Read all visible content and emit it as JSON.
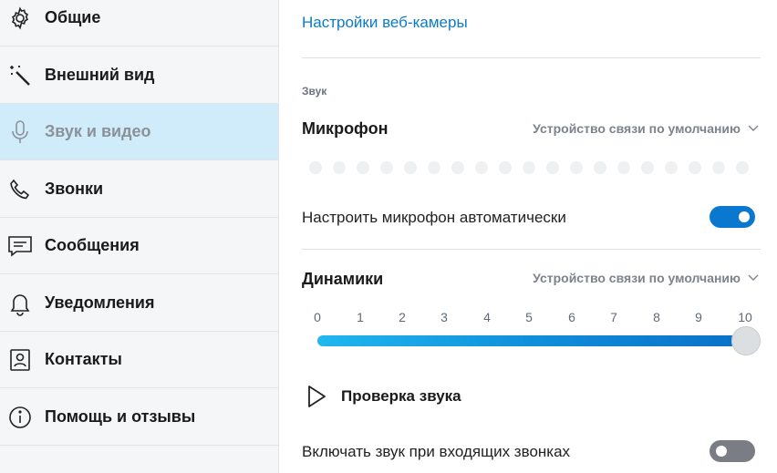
{
  "sidebar": {
    "items": [
      {
        "label": "Общие",
        "icon": "gear-icon"
      },
      {
        "label": "Внешний вид",
        "icon": "magic-wand-icon"
      },
      {
        "label": "Звук и видео",
        "icon": "microphone-icon",
        "active": true
      },
      {
        "label": "Звонки",
        "icon": "phone-icon"
      },
      {
        "label": "Сообщения",
        "icon": "message-icon"
      },
      {
        "label": "Уведомления",
        "icon": "bell-icon"
      },
      {
        "label": "Контакты",
        "icon": "contacts-icon"
      },
      {
        "label": "Помощь и отзывы",
        "icon": "info-icon"
      }
    ]
  },
  "main": {
    "webcam_link": "Настройки веб-камеры",
    "section_label": "Звук",
    "microphone": {
      "heading": "Микрофон",
      "device": "Устройство связи по умолчанию",
      "auto_adjust_label": "Настроить микрофон автоматически",
      "auto_adjust_on": true
    },
    "speakers": {
      "heading": "Динамики",
      "device": "Устройство связи по умолчанию",
      "ticks": [
        "0",
        "1",
        "2",
        "3",
        "4",
        "5",
        "6",
        "7",
        "8",
        "9",
        "10"
      ],
      "volume": 10
    },
    "test_sound_label": "Проверка звука",
    "incoming_calls": {
      "label": "Включать звук при входящих звонках",
      "on": false
    }
  },
  "colors": {
    "accent": "#0b78d0",
    "link": "#0b7bc6",
    "active_bg": "#d0ecfa"
  }
}
